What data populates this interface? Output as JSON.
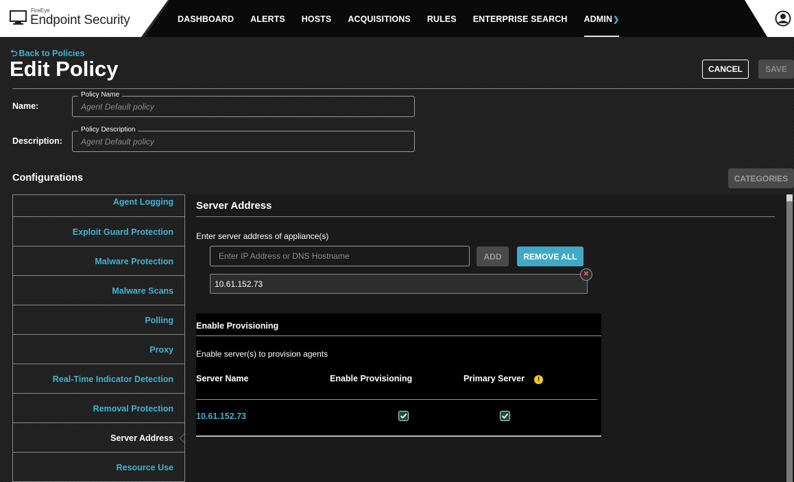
{
  "brand": {
    "vendor": "FireEye",
    "product": "Endpoint Security"
  },
  "nav": {
    "items": [
      {
        "label": "DASHBOARD"
      },
      {
        "label": "ALERTS"
      },
      {
        "label": "HOSTS"
      },
      {
        "label": "ACQUISITIONS"
      },
      {
        "label": "RULES"
      },
      {
        "label": "ENTERPRISE SEARCH"
      },
      {
        "label": "ADMIN"
      }
    ],
    "active": "ADMIN"
  },
  "header": {
    "back_label": "Back to Policies",
    "title": "Edit Policy",
    "cancel_label": "CANCEL",
    "save_label": "SAVE"
  },
  "form": {
    "name_label": "Name:",
    "name_legend": "Policy Name",
    "name_value": "Agent Default policy",
    "description_label": "Description:",
    "description_legend": "Policy Description",
    "description_value": "Agent Default policy"
  },
  "configurations": {
    "title": "Configurations",
    "categories_label": "CATEGORIES",
    "items": [
      {
        "label": "Agent Logging"
      },
      {
        "label": "Exploit Guard Protection"
      },
      {
        "label": "Malware Protection"
      },
      {
        "label": "Malware Scans"
      },
      {
        "label": "Polling"
      },
      {
        "label": "Proxy"
      },
      {
        "label": "Real-Time Indicator Detection"
      },
      {
        "label": "Removal Protection"
      },
      {
        "label": "Server Address"
      },
      {
        "label": "Resource Use"
      }
    ],
    "active": "Server Address"
  },
  "server_address": {
    "title": "Server Address",
    "enter_label": "Enter server address of appliance(s)",
    "input_placeholder": "Enter IP Address or DNS Hostname",
    "add_label": "ADD",
    "remove_all_label": "REMOVE ALL",
    "addresses": [
      "10.61.152.73"
    ],
    "provisioning": {
      "title": "Enable Provisioning",
      "description": "Enable server(s) to provision agents",
      "columns": {
        "server_name": "Server Name",
        "enable_provisioning": "Enable Provisioning",
        "primary_server": "Primary Server"
      },
      "rows": [
        {
          "server_name": "10.61.152.73",
          "enable_provisioning": true,
          "primary_server": true
        }
      ]
    }
  },
  "colors": {
    "accent": "#3fb4d4",
    "background": "#1f1f1f",
    "warning": "#f3cd1a"
  }
}
